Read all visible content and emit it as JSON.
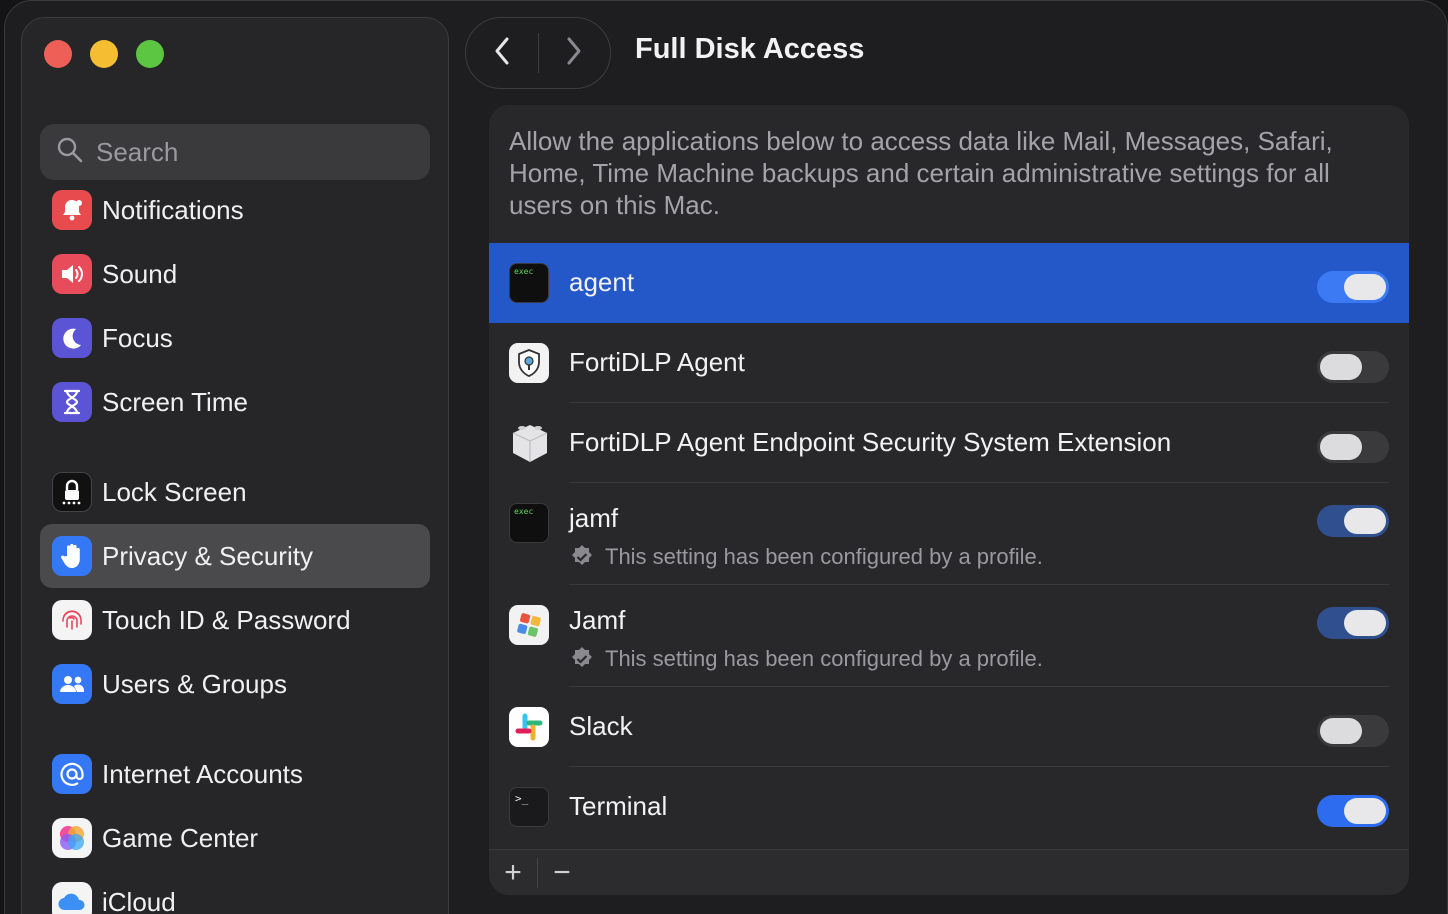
{
  "window": {
    "title": "Full Disk Access"
  },
  "search": {
    "placeholder": "Search"
  },
  "sidebar": {
    "items": [
      {
        "label": "Notifications",
        "icon": "bell-icon",
        "color": "#e84b4e"
      },
      {
        "label": "Sound",
        "icon": "speaker-icon",
        "color": "#e84b5a"
      },
      {
        "label": "Focus",
        "icon": "moon-icon",
        "color": "#5b55d6"
      },
      {
        "label": "Screen Time",
        "icon": "hourglass-icon",
        "color": "#5b55d6"
      },
      {
        "label": "Lock Screen",
        "icon": "lock-icon",
        "color": "#111111"
      },
      {
        "label": "Privacy & Security",
        "icon": "hand-icon",
        "color": "#3478f6",
        "selected": true
      },
      {
        "label": "Touch ID & Password",
        "icon": "fingerprint-icon",
        "color": "#f4f4f4"
      },
      {
        "label": "Users & Groups",
        "icon": "users-icon",
        "color": "#3478f6"
      },
      {
        "label": "Internet Accounts",
        "icon": "at-icon",
        "color": "#3478f6"
      },
      {
        "label": "Game Center",
        "icon": "game-center-icon",
        "color": "#f4f4f4"
      },
      {
        "label": "iCloud",
        "icon": "cloud-icon",
        "color": "#f4f4f4"
      }
    ]
  },
  "main": {
    "description": "Allow the applications below to access data like Mail, Messages, Safari, Home, Time Machine backups and certain administrative settings for all users on this Mac.",
    "apps": [
      {
        "name": "agent",
        "enabled": true,
        "selected": true,
        "icon": "exec-icon",
        "icon_text": "exec"
      },
      {
        "name": "FortiDLP Agent",
        "enabled": false,
        "icon": "fortidlp-shield-icon"
      },
      {
        "name": "FortiDLP Agent Endpoint Security System Extension",
        "enabled": false,
        "icon": "system-extension-icon"
      },
      {
        "name": "jamf",
        "enabled": true,
        "managed": true,
        "note": "This setting has been configured by a profile.",
        "icon": "exec-icon",
        "icon_text": "exec"
      },
      {
        "name": "Jamf",
        "enabled": true,
        "managed": true,
        "note": "This setting has been configured by a profile.",
        "icon": "jamf-icon"
      },
      {
        "name": "Slack",
        "enabled": false,
        "icon": "slack-icon"
      },
      {
        "name": "Terminal",
        "enabled": true,
        "icon": "terminal-icon",
        "icon_text": ">_"
      }
    ],
    "add_label": "+",
    "remove_label": "−"
  },
  "colors": {
    "accent": "#2d6bef",
    "selected_row": "#2458c9"
  }
}
